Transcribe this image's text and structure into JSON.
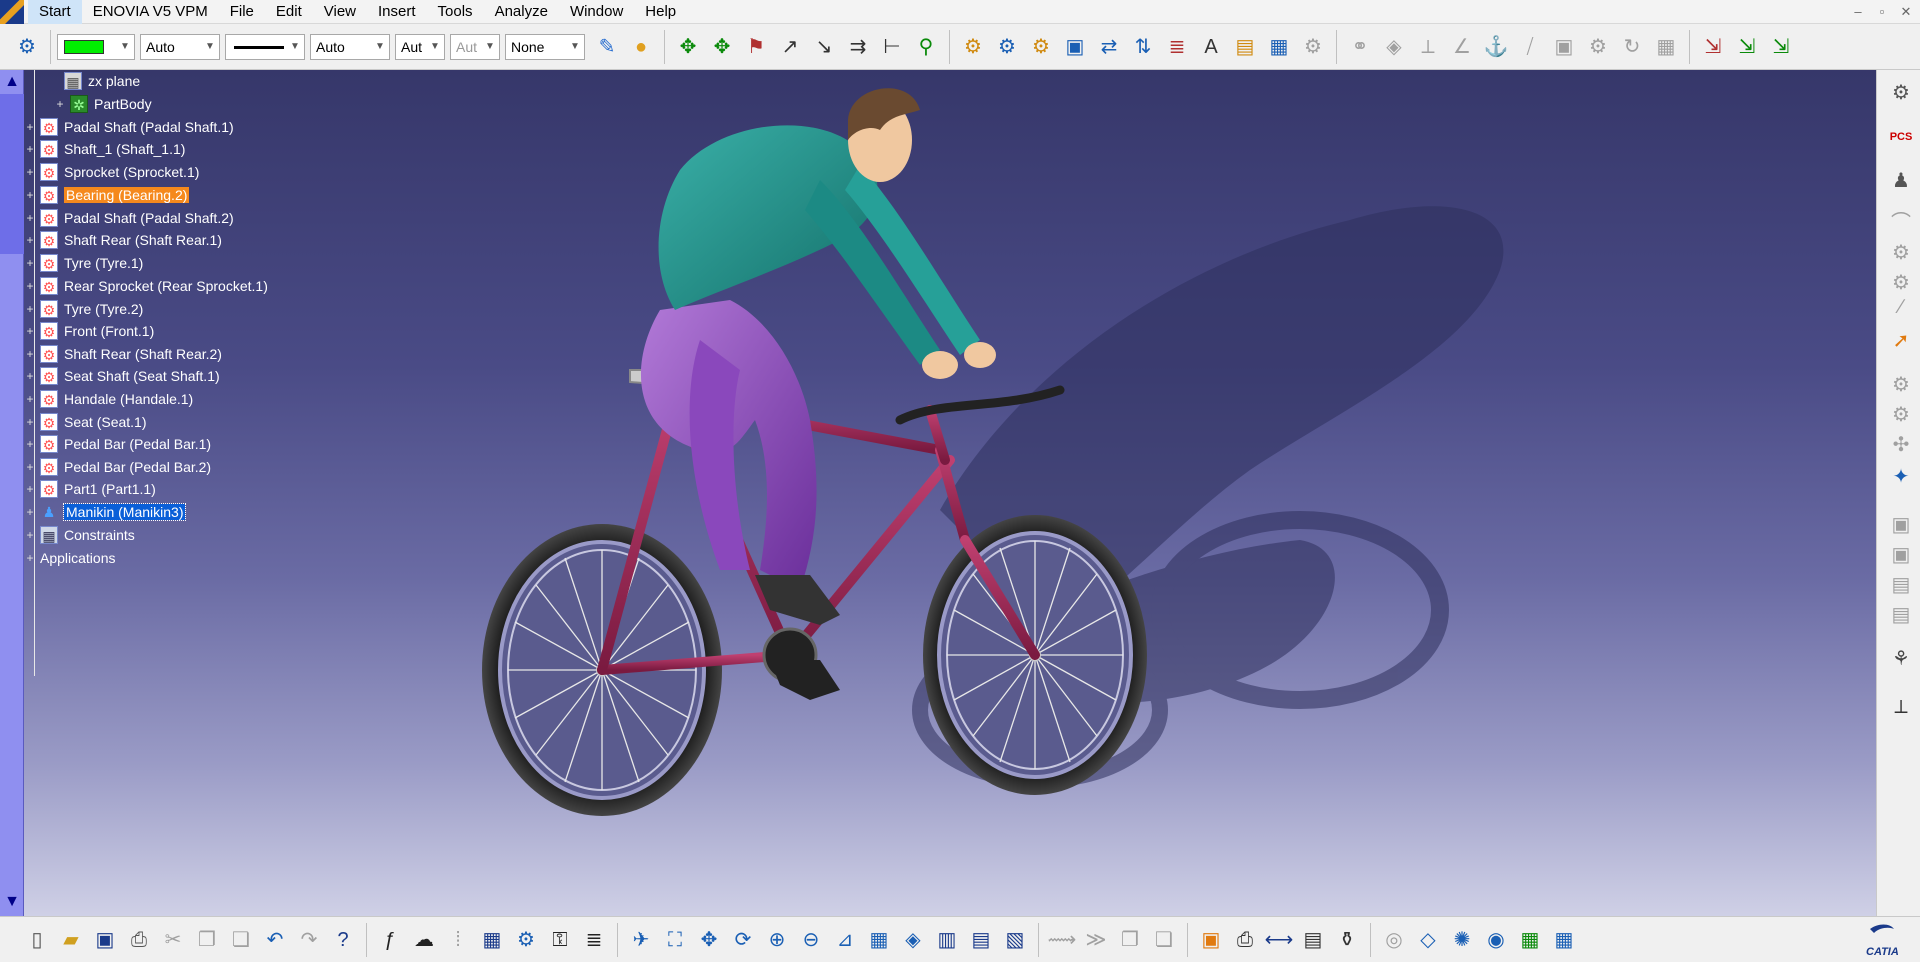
{
  "menu": {
    "items": [
      "Start",
      "ENOVIA V5 VPM",
      "File",
      "Edit",
      "View",
      "Insert",
      "Tools",
      "Analyze",
      "Window",
      "Help"
    ],
    "window_controls": [
      "–",
      "▫",
      "✕"
    ]
  },
  "toolbar_top": {
    "color_combo": {
      "value": "",
      "color": "#00ee00"
    },
    "transparency_combo": {
      "value": "Auto"
    },
    "lineweight_combo": {
      "value": ""
    },
    "linetype_combo": {
      "value": "Auto"
    },
    "point_combo": {
      "value": "Aut"
    },
    "layer_combo_disabled": {
      "value": "Aut"
    },
    "layer_combo": {
      "value": "None"
    }
  },
  "tree": {
    "items": [
      {
        "label": "zx plane",
        "icon": "plane-icon"
      },
      {
        "label": "PartBody",
        "icon": "partbody-icon"
      },
      {
        "label": "Padal Shaft (Padal Shaft.1)",
        "icon": "part-icon"
      },
      {
        "label": "Shaft_1 (Shaft_1.1)",
        "icon": "part-icon"
      },
      {
        "label": "Sprocket (Sprocket.1)",
        "icon": "part-icon"
      },
      {
        "label": "Bearing (Bearing.2)",
        "icon": "part-icon",
        "highlight": "orange"
      },
      {
        "label": "Padal Shaft (Padal Shaft.2)",
        "icon": "part-icon"
      },
      {
        "label": "Shaft Rear (Shaft Rear.1)",
        "icon": "part-icon"
      },
      {
        "label": "Tyre (Tyre.1)",
        "icon": "part-icon"
      },
      {
        "label": "Rear Sprocket (Rear Sprocket.1)",
        "icon": "part-icon"
      },
      {
        "label": "Tyre (Tyre.2)",
        "icon": "part-icon"
      },
      {
        "label": "Front (Front.1)",
        "icon": "part-icon"
      },
      {
        "label": "Shaft Rear (Shaft Rear.2)",
        "icon": "part-icon"
      },
      {
        "label": "Seat Shaft (Seat Shaft.1)",
        "icon": "part-icon"
      },
      {
        "label": "Handale (Handale.1)",
        "icon": "part-icon"
      },
      {
        "label": "Seat (Seat.1)",
        "icon": "part-icon"
      },
      {
        "label": "Pedal Bar (Pedal Bar.1)",
        "icon": "part-icon"
      },
      {
        "label": "Pedal Bar (Pedal Bar.2)",
        "icon": "part-icon"
      },
      {
        "label": "Part1 (Part1.1)",
        "icon": "part-icon"
      },
      {
        "label": "Manikin (Manikin3)",
        "icon": "manikin-icon",
        "highlight": "blue"
      },
      {
        "label": "Constraints",
        "icon": "constraints-icon"
      },
      {
        "label": "Applications",
        "icon": "none"
      }
    ]
  },
  "right_toolbar": {
    "pcs_label": "PCS"
  },
  "brand": {
    "catia_label": "CATIA"
  }
}
